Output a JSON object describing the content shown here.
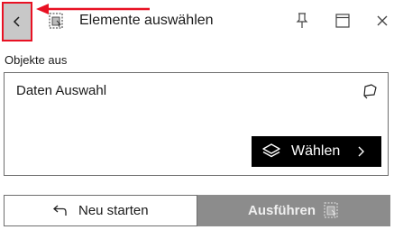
{
  "header": {
    "title": "Elemente auswählen",
    "back_icon": "chevron-left-icon",
    "title_icon": "select-elements-icon",
    "pin_icon": "pin-icon",
    "maximize_icon": "maximize-icon",
    "close_icon": "close-icon",
    "highlight_color": "#e81123"
  },
  "objects": {
    "section_label": "Objekte aus",
    "panel_title": "Daten Auswahl",
    "select_icon": "lasso-select-icon",
    "choose_button_label": "Wählen",
    "choose_button_icon": "layers-icon"
  },
  "footer": {
    "restart_label": "Neu starten",
    "restart_icon": "undo-arrow-icon",
    "run_label": "Ausführen",
    "run_icon": "select-elements-icon",
    "run_enabled": false
  }
}
